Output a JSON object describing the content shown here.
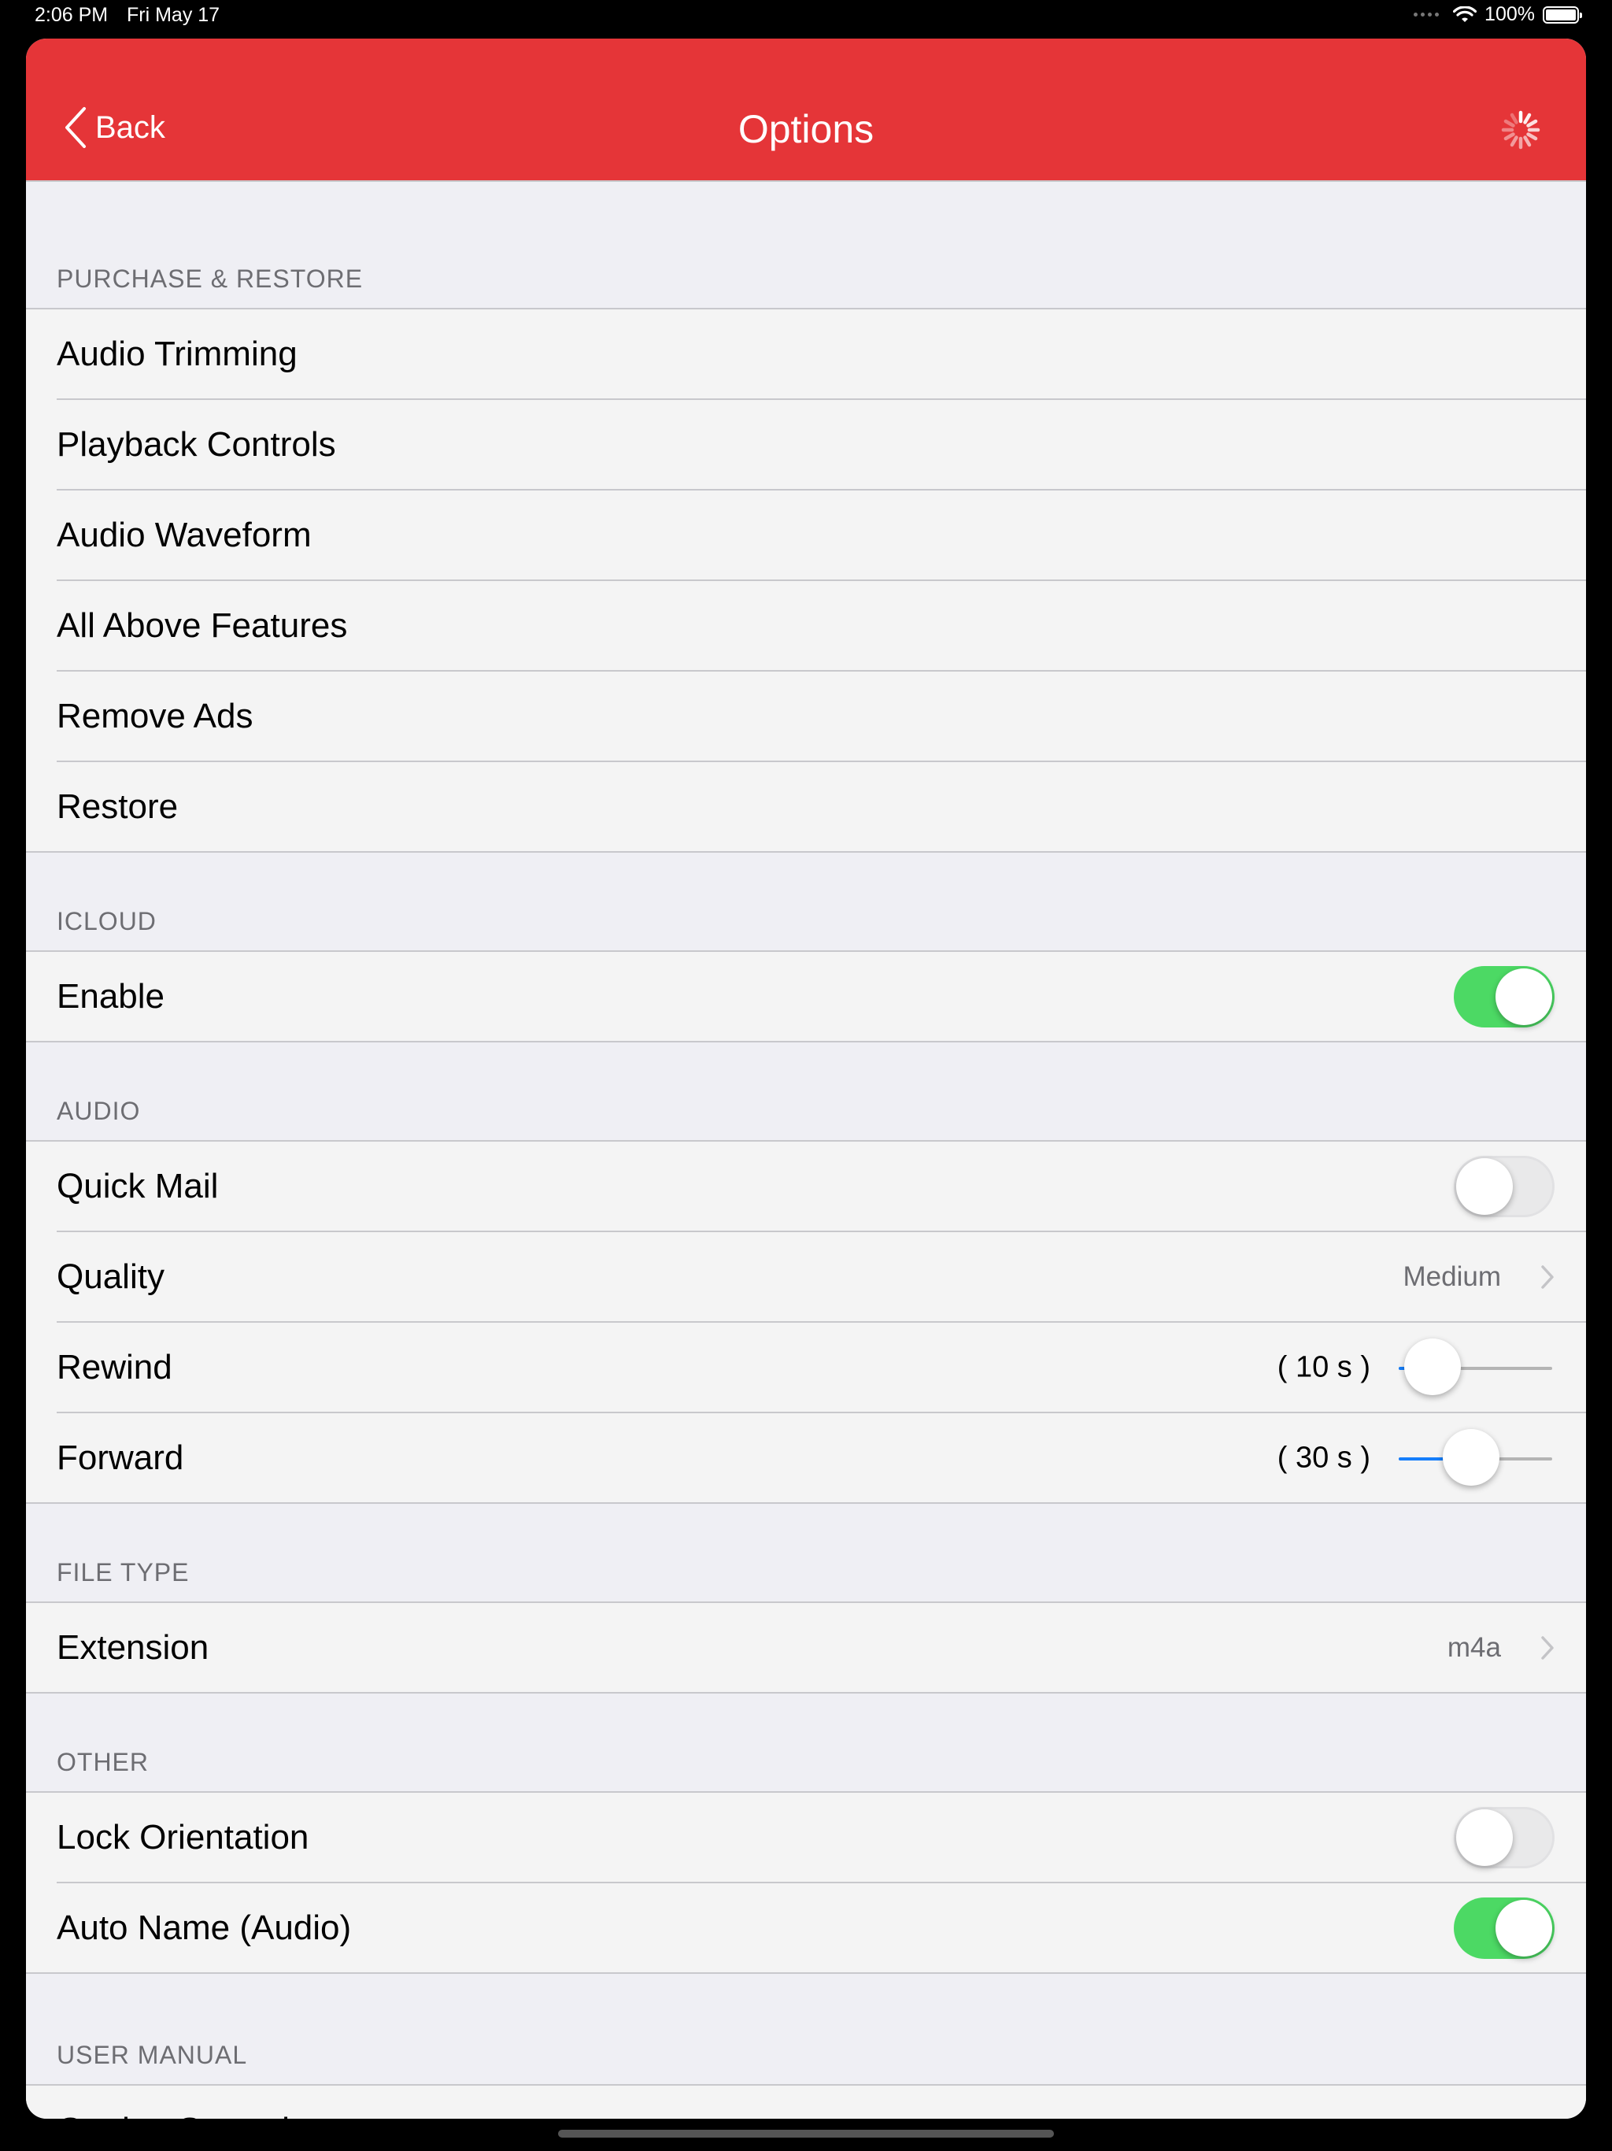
{
  "status_bar": {
    "time": "2:06 PM",
    "date": "Fri May 17",
    "battery": "100%"
  },
  "navbar": {
    "back_label": "Back",
    "title": "Options",
    "color": "#e53538"
  },
  "sections": {
    "purchase": {
      "header": "PURCHASE & RESTORE",
      "items": [
        "Audio Trimming",
        "Playback Controls",
        "Audio Waveform",
        "All Above Features",
        "Remove Ads",
        "Restore"
      ]
    },
    "icloud": {
      "header": "ICLOUD",
      "enable": {
        "label": "Enable",
        "on": true
      }
    },
    "audio": {
      "header": "AUDIO",
      "quick_mail": {
        "label": "Quick Mail",
        "on": false
      },
      "quality": {
        "label": "Quality",
        "value": "Medium"
      },
      "rewind": {
        "label": "Rewind",
        "value_text": "( 10 s )",
        "level": 0.22
      },
      "forward": {
        "label": "Forward",
        "value_text": "( 30 s )",
        "level": 0.47
      }
    },
    "file_type": {
      "header": "FILE TYPE",
      "extension": {
        "label": "Extension",
        "value": "m4a"
      }
    },
    "other": {
      "header": "OTHER",
      "lock_orientation": {
        "label": "Lock Orientation",
        "on": false
      },
      "auto_name": {
        "label": "Auto Name (Audio)",
        "on": true
      }
    },
    "user_manual": {
      "header": "USER MANUAL",
      "getting_started": {
        "label": "Getting Started"
      }
    }
  },
  "colors": {
    "accent": "#e53538",
    "toggle_on": "#4cd964",
    "slider_fill": "#157efb",
    "background": "#efeff4"
  }
}
